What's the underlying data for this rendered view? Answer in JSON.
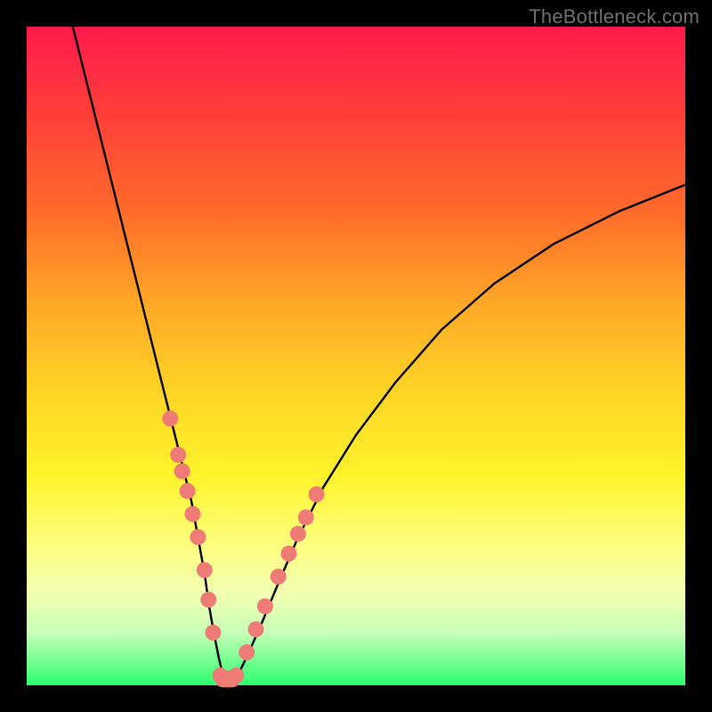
{
  "watermark": "TheBottleneck.com",
  "chart_data": {
    "type": "line",
    "title": "",
    "xlabel": "",
    "ylabel": "",
    "xlim": [
      0,
      100
    ],
    "ylim": [
      0,
      100
    ],
    "curve": {
      "name": "bottleneck-curve",
      "x": [
        7,
        9,
        11,
        13,
        15,
        17,
        19,
        20.5,
        22,
        23.5,
        25,
        26,
        27,
        27.7,
        28.4,
        29.2,
        30,
        31,
        32,
        33.5,
        35.5,
        38,
        41,
        45,
        50,
        56,
        63,
        71,
        80,
        90,
        100
      ],
      "y": [
        100,
        92,
        84,
        76,
        68,
        60,
        52,
        46,
        40,
        34,
        28,
        22.5,
        17,
        12,
        8,
        4,
        0.7,
        0.5,
        1.4,
        4.5,
        9,
        15,
        22,
        30,
        38,
        46,
        54,
        61,
        67,
        72,
        76
      ]
    },
    "markers": {
      "name": "highlight-dots",
      "color": "#ef7b77",
      "radius": 9,
      "points": [
        {
          "x": 21.8,
          "y": 40.5
        },
        {
          "x": 23.0,
          "y": 35.0
        },
        {
          "x": 23.6,
          "y": 32.5
        },
        {
          "x": 24.4,
          "y": 29.5
        },
        {
          "x": 25.2,
          "y": 26.0
        },
        {
          "x": 26.0,
          "y": 22.5
        },
        {
          "x": 27.0,
          "y": 17.5
        },
        {
          "x": 27.6,
          "y": 13.0
        },
        {
          "x": 28.3,
          "y": 8.0
        },
        {
          "x": 29.4,
          "y": 1.5
        },
        {
          "x": 30.6,
          "y": 1.0
        },
        {
          "x": 31.8,
          "y": 1.5
        },
        {
          "x": 33.4,
          "y": 5.0
        },
        {
          "x": 34.8,
          "y": 8.5
        },
        {
          "x": 36.2,
          "y": 12.0
        },
        {
          "x": 38.2,
          "y": 16.5
        },
        {
          "x": 39.8,
          "y": 20.0
        },
        {
          "x": 41.2,
          "y": 23.0
        },
        {
          "x": 42.4,
          "y": 25.5
        },
        {
          "x": 44.0,
          "y": 29.0
        }
      ],
      "bridge": [
        {
          "x": 29.8,
          "y": 0.9
        },
        {
          "x": 31.2,
          "y": 0.9
        }
      ]
    }
  }
}
